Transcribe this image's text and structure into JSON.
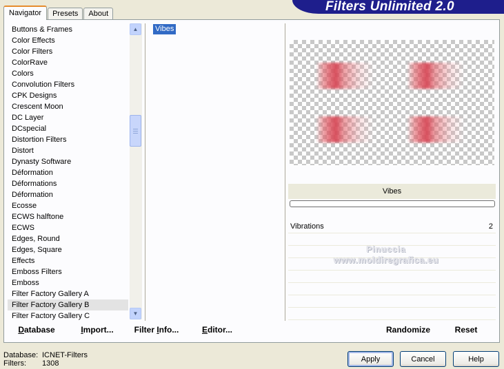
{
  "tabs": [
    {
      "label": "Navigator",
      "active": true
    },
    {
      "label": "Presets",
      "active": false
    },
    {
      "label": "About",
      "active": false
    }
  ],
  "banner": {
    "title": "Filters Unlimited 2.0"
  },
  "categories": [
    "Buttons & Frames",
    "Color Effects",
    "Color Filters",
    "ColorRave",
    "Colors",
    "Convolution Filters",
    "CPK Designs",
    "Crescent Moon",
    "DC Layer",
    "DCspecial",
    "Distortion Filters",
    "Distort",
    "Dynasty Software",
    "Déformation",
    "Déformations",
    "Déformation",
    "Ecosse",
    "ECWS halftone",
    "ECWS",
    "Edges, Round",
    "Edges, Square",
    "Effects",
    "Emboss Filters",
    "Emboss",
    "Filter Factory Gallery A",
    "Filter Factory Gallery B",
    "Filter Factory Gallery C"
  ],
  "selected_category": "Filter Factory Gallery B",
  "filters": [
    {
      "label": "Vibes",
      "selected": true
    }
  ],
  "parameters": {
    "filter_name": "Vibes",
    "rows": [
      {
        "name": "Vibrations",
        "value": "2"
      }
    ]
  },
  "watermark": {
    "line1": "Pinuccia",
    "line2": "www.moldiregrafica.eu"
  },
  "toolbar": {
    "database": {
      "u": "D",
      "rest": "atabase"
    },
    "import": {
      "u": "I",
      "rest": "mport..."
    },
    "filter_info": {
      "pre": "Filter ",
      "u": "I",
      "rest": "nfo..."
    },
    "editor": {
      "u": "E",
      "rest": "ditor..."
    },
    "randomize": "Randomize",
    "reset": "Reset"
  },
  "status": {
    "database_label": "Database:",
    "database_value": "ICNET-Filters",
    "filters_label": "Filters:",
    "filters_value": "1308"
  },
  "buttons": {
    "apply": "Apply",
    "cancel": "Cancel",
    "help": "Help"
  },
  "colors": {
    "banner": "#1e1e8c",
    "selection": "#316ac5",
    "preview_tint": "#dc5060"
  }
}
